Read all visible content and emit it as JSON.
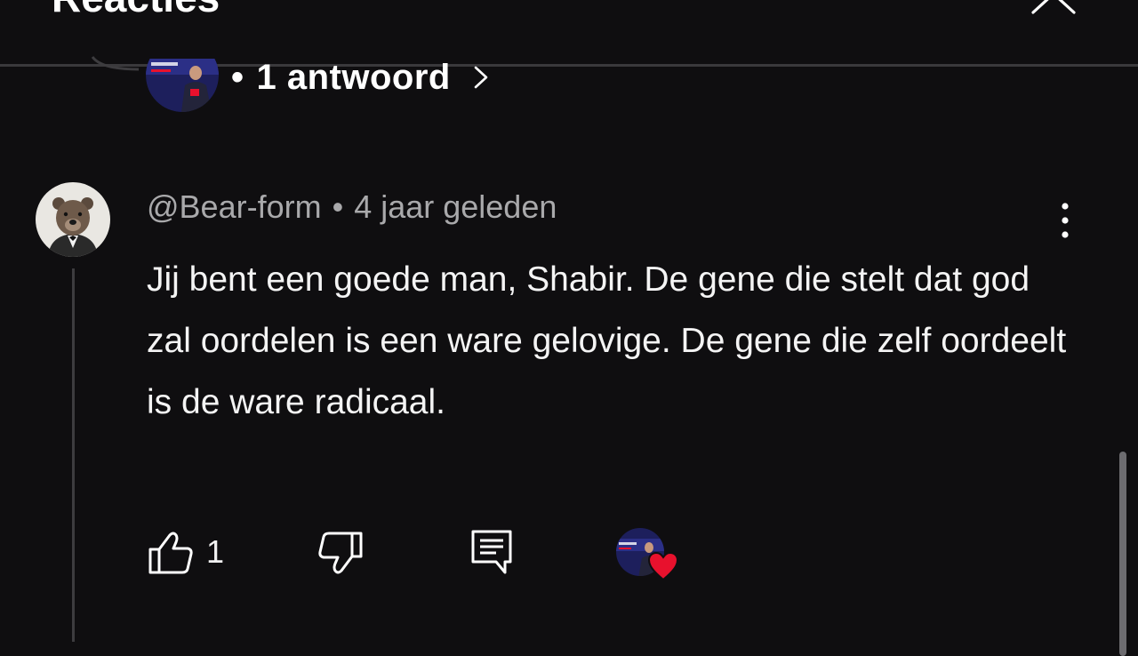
{
  "header": {
    "title": "Reacties",
    "close_icon": "close-icon"
  },
  "reply_summary": {
    "dot": "•",
    "label": "1 antwoord",
    "icon": "chevron-right-icon"
  },
  "comment": {
    "author": "@Bear-form",
    "separator": "•",
    "time": "4 jaar geleden",
    "text": "Jij bent een goede man, Shabir. De gene die stelt dat god zal oordelen is een ware gelovige. De gene die zelf oordeelt is de ware radicaal.",
    "like_count": "1",
    "icons": [
      "thumbs-up-icon",
      "thumbs-down-icon",
      "reply-icon",
      "heart-icon",
      "more-vert-icon"
    ]
  },
  "colors": {
    "background": "#0f0e10",
    "text": "#f1f1f1",
    "meta_text": "#a9a9ab",
    "heart": "#e8112d"
  }
}
